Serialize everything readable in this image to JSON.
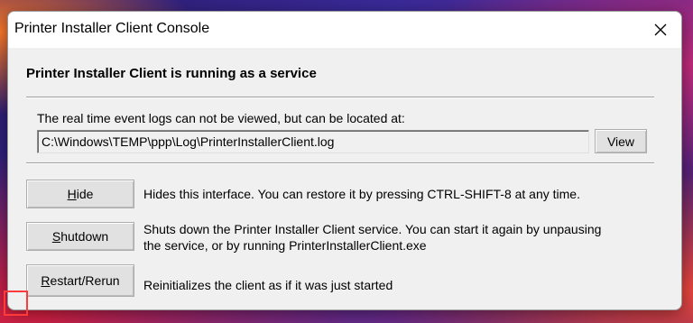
{
  "window": {
    "title": "Printer Installer Client Console"
  },
  "heading": "Printer Installer Client is running as a service",
  "log_section": {
    "description": "The real time event logs can not be viewed, but can be located at:",
    "path_value": "C:\\Windows\\TEMP\\ppp\\Log\\PrinterInstallerClient.log",
    "view_label": "View"
  },
  "actions": [
    {
      "label_accel": "H",
      "label_rest": "ide",
      "description": "Hides this interface.  You can restore it by pressing CTRL-SHIFT-8 at any time."
    },
    {
      "label_accel": "S",
      "label_rest": "hutdown",
      "description_line1": "Shuts down the Printer Installer Client service.  You can start it again by unpausing",
      "description_line2": "the service, or by running PrinterInstallerClient.exe"
    },
    {
      "label_accel": "R",
      "label_rest": "estart/Rerun",
      "description": "Reinitializes the client as if it was just started"
    }
  ],
  "icons": {
    "close": "close-icon"
  },
  "colors": {
    "dialog_bg": "#f0f0f0",
    "titlebar_bg": "#ffffff",
    "button_bg": "#e1e1e1",
    "highlight_marker": "#ff3a3a"
  }
}
